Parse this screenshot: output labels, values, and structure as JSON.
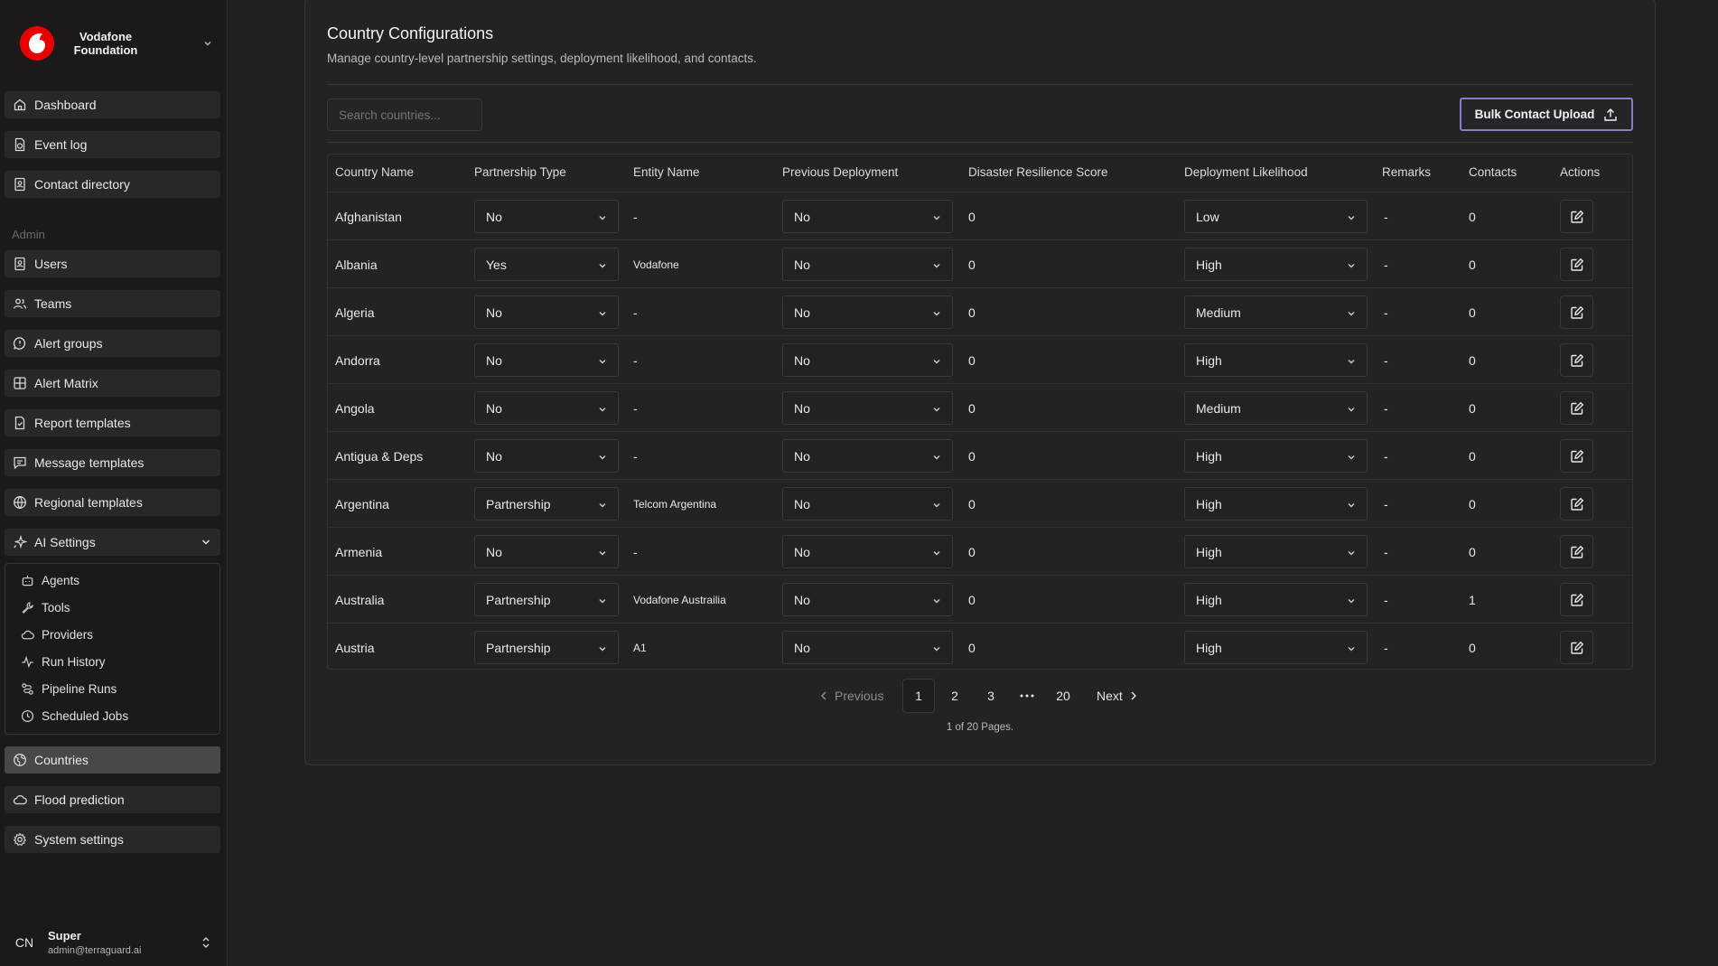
{
  "brand": {
    "name_line1": "Vodafone",
    "name_line2": "Foundation"
  },
  "sidebar": {
    "items_top": [
      {
        "label": "Dashboard",
        "icon": "home-icon"
      },
      {
        "label": "Event log",
        "icon": "event-log-icon"
      },
      {
        "label": "Contact directory",
        "icon": "contact-book-icon"
      }
    ],
    "admin_label": "Admin",
    "items_admin": [
      {
        "label": "Users",
        "icon": "users-icon"
      },
      {
        "label": "Teams",
        "icon": "teams-icon"
      },
      {
        "label": "Alert groups",
        "icon": "alert-icon"
      },
      {
        "label": "Alert Matrix",
        "icon": "matrix-icon"
      },
      {
        "label": "Report templates",
        "icon": "report-icon"
      },
      {
        "label": "Message templates",
        "icon": "message-icon"
      },
      {
        "label": "Regional templates",
        "icon": "globe-icon"
      },
      {
        "label": "AI Settings",
        "icon": "sparkles-icon"
      }
    ],
    "ai_sub_items": [
      {
        "label": "Agents",
        "icon": "bot-icon"
      },
      {
        "label": "Tools",
        "icon": "wrench-icon"
      },
      {
        "label": "Providers",
        "icon": "cloud-icon"
      },
      {
        "label": "Run History",
        "icon": "activity-icon"
      },
      {
        "label": "Pipeline Runs",
        "icon": "workflow-icon"
      },
      {
        "label": "Scheduled Jobs",
        "icon": "clock-icon"
      }
    ],
    "items_bottom": [
      {
        "label": "Countries",
        "icon": "globe-icon",
        "active": true
      },
      {
        "label": "Flood prediction",
        "icon": "cloud-icon"
      },
      {
        "label": "System settings",
        "icon": "gear-icon"
      }
    ],
    "user": {
      "initials": "CN",
      "name": "Super",
      "email": "admin@terraguard.ai"
    }
  },
  "page": {
    "title": "Country Configurations",
    "description": "Manage country-level partnership settings, deployment likelihood, and contacts.",
    "search_placeholder": "Search countries...",
    "bulk_button": "Bulk Contact Upload"
  },
  "table": {
    "headers": [
      "Country Name",
      "Partnership Type",
      "Entity Name",
      "Previous Deployment",
      "Disaster Resilience Score",
      "Deployment Likelihood",
      "Remarks",
      "Contacts",
      "Actions"
    ],
    "rows": [
      {
        "country": "Afghanistan",
        "partnership": "No",
        "entity": "-",
        "prev": "No",
        "score": "0",
        "likelihood": "Low",
        "remarks": "-",
        "contacts": "0"
      },
      {
        "country": "Albania",
        "partnership": "Yes",
        "entity": "Vodafone",
        "prev": "No",
        "score": "0",
        "likelihood": "High",
        "remarks": "-",
        "contacts": "0"
      },
      {
        "country": "Algeria",
        "partnership": "No",
        "entity": "-",
        "prev": "No",
        "score": "0",
        "likelihood": "Medium",
        "remarks": "-",
        "contacts": "0"
      },
      {
        "country": "Andorra",
        "partnership": "No",
        "entity": "-",
        "prev": "No",
        "score": "0",
        "likelihood": "High",
        "remarks": "-",
        "contacts": "0"
      },
      {
        "country": "Angola",
        "partnership": "No",
        "entity": "-",
        "prev": "No",
        "score": "0",
        "likelihood": "Medium",
        "remarks": "-",
        "contacts": "0"
      },
      {
        "country": "Antigua & Deps",
        "partnership": "No",
        "entity": "-",
        "prev": "No",
        "score": "0",
        "likelihood": "High",
        "remarks": "-",
        "contacts": "0"
      },
      {
        "country": "Argentina",
        "partnership": "Partnership",
        "entity": "Telcom Argentina",
        "prev": "No",
        "score": "0",
        "likelihood": "High",
        "remarks": "-",
        "contacts": "0"
      },
      {
        "country": "Armenia",
        "partnership": "No",
        "entity": "-",
        "prev": "No",
        "score": "0",
        "likelihood": "High",
        "remarks": "-",
        "contacts": "0"
      },
      {
        "country": "Australia",
        "partnership": "Partnership",
        "entity": "Vodafone Austrailia",
        "prev": "No",
        "score": "0",
        "likelihood": "High",
        "remarks": "-",
        "contacts": "1"
      },
      {
        "country": "Austria",
        "partnership": "Partnership",
        "entity": "A1",
        "prev": "No",
        "score": "0",
        "likelihood": "High",
        "remarks": "-",
        "contacts": "0"
      }
    ]
  },
  "pagination": {
    "previous": "Previous",
    "next": "Next",
    "pages": [
      "1",
      "2",
      "3",
      "...",
      "20"
    ],
    "current": "1",
    "info": "1 of 20 Pages."
  }
}
